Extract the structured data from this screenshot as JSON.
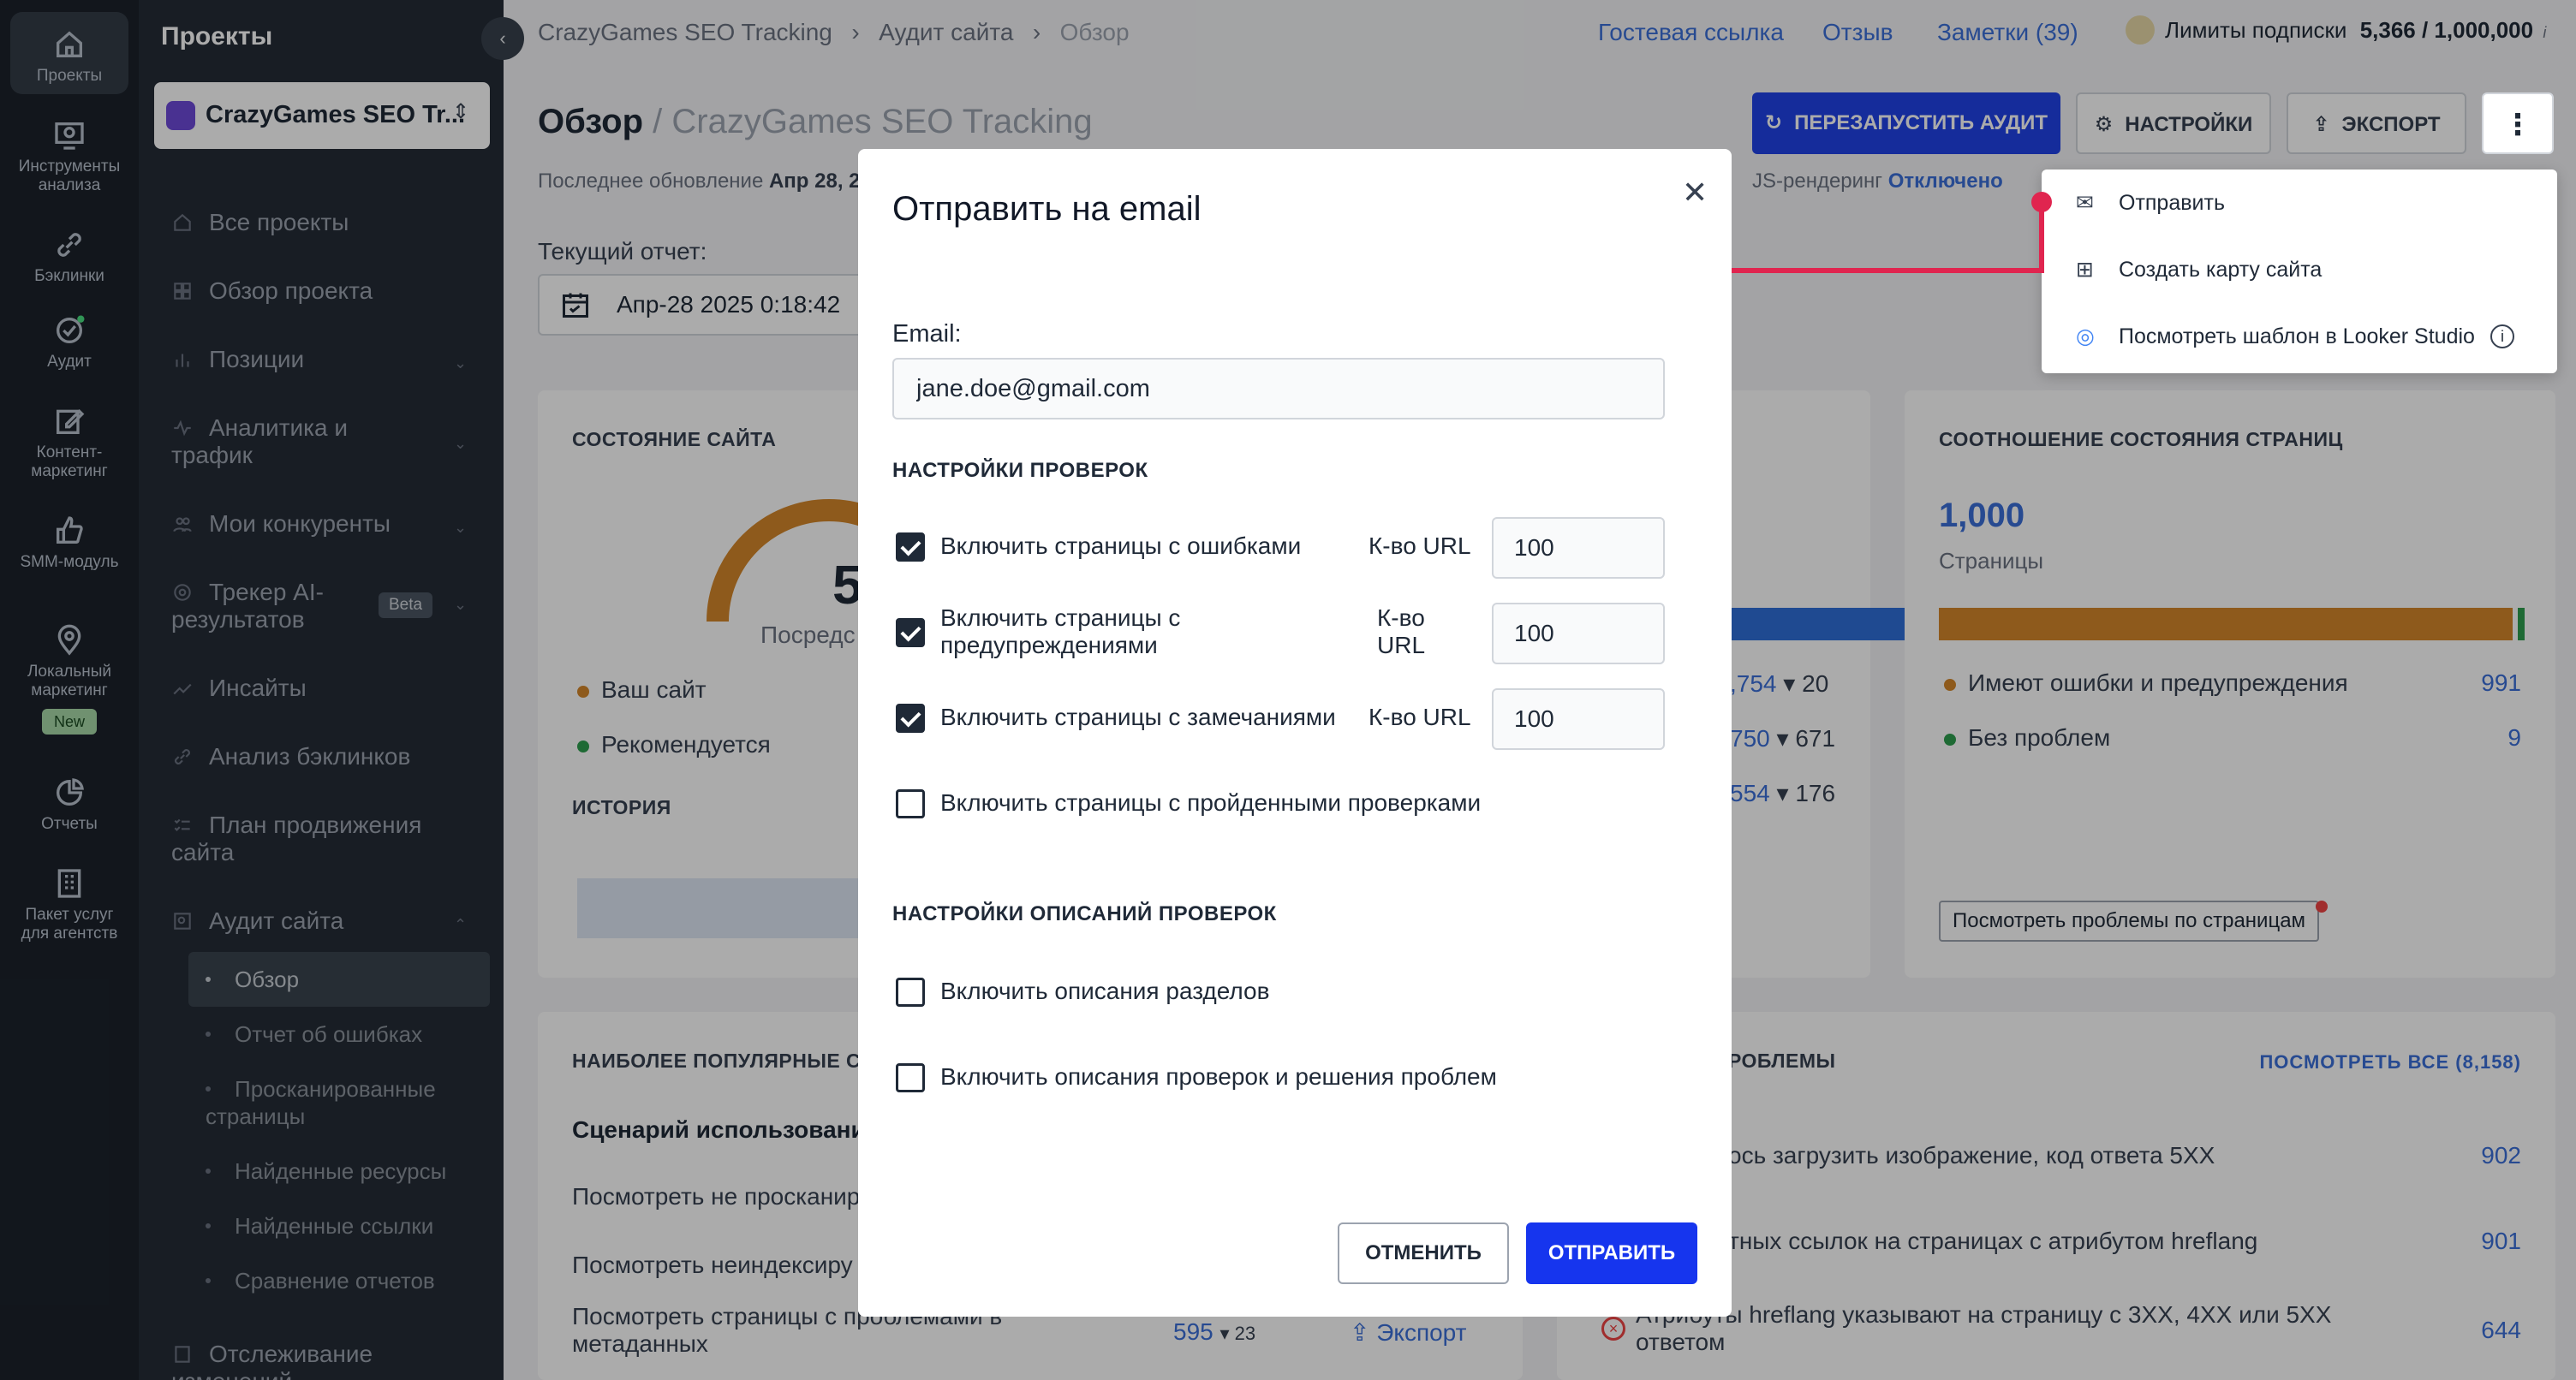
{
  "rail": [
    {
      "label": "Проекты",
      "icon": "home-icon"
    },
    {
      "label": "Инструменты анализа",
      "icon": "analysis-icon"
    },
    {
      "label": "Бэклинки",
      "icon": "link-icon"
    },
    {
      "label": "Аудит",
      "icon": "audit-icon"
    },
    {
      "label": "Контент-маркетинг",
      "icon": "edit-icon"
    },
    {
      "label": "SMM-модуль",
      "icon": "thumb-icon"
    },
    {
      "label": "Локальный маркетинг",
      "icon": "pin-icon",
      "badge": "New"
    },
    {
      "label": "Отчеты",
      "icon": "pie-icon"
    },
    {
      "label": "Пакет услуг для агентств",
      "icon": "building-icon"
    }
  ],
  "sidebar": {
    "title": "Проекты",
    "project": "CrazyGames SEO Tr...",
    "nav": [
      {
        "label": "Все проекты"
      },
      {
        "label": "Обзор проекта"
      },
      {
        "label": "Позиции"
      },
      {
        "label": "Аналитика и трафик"
      },
      {
        "label": "Мои конкуренты"
      },
      {
        "label": "Трекер AI-результатов",
        "badge": "Beta"
      },
      {
        "label": "Инсайты"
      },
      {
        "label": "Анализ бэклинков"
      },
      {
        "label": "План продвижения сайта"
      },
      {
        "label": "Аудит сайта"
      }
    ],
    "sub": [
      "Обзор",
      "Отчет об ошибках",
      "Просканированные страницы",
      "Найденные ресурсы",
      "Найденные ссылки",
      "Сравнение отчетов"
    ],
    "last": "Отслеживание изменений"
  },
  "topbar": {
    "crumbs": [
      "CrazyGames SEO Tracking",
      "Аудит сайта",
      "Обзор"
    ],
    "links": [
      "Гостевая ссылка",
      "Отзыв",
      "Заметки (39)"
    ],
    "limits_label": "Лимиты подписки",
    "limits_value": "5,366 / 1,000,000"
  },
  "page": {
    "title": "Обзор",
    "subtitle": "/ CrazyGames SEO Tracking",
    "updated_label": "Последнее обновление",
    "updated_value": "Апр 28, 2",
    "js_label": "JS-рендеринг",
    "js_value": "Отключено",
    "report_label": "Текущий отчет:",
    "report_value": "Апр-28 2025 0:18:42",
    "btn_restart": "ПЕРЕЗАПУСТИТЬ АУДИТ",
    "btn_settings": "НАСТРОЙКИ",
    "btn_export": "ЭКСПОРТ"
  },
  "cards": {
    "site_state": {
      "title": "СОСТОЯНИЕ САЙТА",
      "big": "5",
      "avg": "Посредс",
      "your_site": "Ваш сайт",
      "recommended": "Рекомендуется",
      "history": "ИСТОРИЯ"
    },
    "mid": {
      "r1a": ",754",
      "r1b": "20",
      "r2a": "750",
      "r2b": "671",
      "r3a": "554",
      "r3b": "176"
    },
    "ratio": {
      "title": "СООТНОШЕНИЕ СОСТОЯНИЯ СТРАНИЦ",
      "value": "1,000",
      "unit": "Страницы",
      "row1": "Имеют ошибки и предупреждения",
      "row1v": "991",
      "row2": "Без проблем",
      "row2v": "9",
      "btn": "Посмотреть проблемы по страницам",
      "orange": "#d4872a",
      "green": "#2e9e4e"
    },
    "popular": {
      "title": "НАИБОЛЕЕ ПОПУЛЯРНЫЕ СЦ",
      "scenario": "Сценарий использовани",
      "r1": "Посмотреть не просканир",
      "r2": "Посмотреть неиндексиру",
      "r3": "Посмотреть страницы с проблемами в метаданных",
      "r3a": "595",
      "r3b": "23",
      "r3c": "Экспорт"
    },
    "problems": {
      "title": "РОБЛЕМЫ",
      "view_all": "ПОСМОТРЕТЬ ВСЕ (8,158)",
      "p1": "ось загрузить изображение, код ответа 5XX",
      "p1v": "902",
      "p2": "тных ссылок на страницах с атрибутом hreflang",
      "p2v": "901",
      "p3": "Атрибуты hreflang указывают на страницу с 3XX, 4XX или 5XX ответом",
      "p3v": "644"
    }
  },
  "dropdown": {
    "items": [
      {
        "label": "Отправить",
        "icon": "mail-icon"
      },
      {
        "label": "Создать карту сайта",
        "icon": "sitemap-icon"
      },
      {
        "label": "Посмотреть шаблон в Looker Studio",
        "icon": "looker-icon"
      }
    ]
  },
  "modal": {
    "title": "Отправить на email",
    "email_label": "Email:",
    "email_value": "jane.doe@gmail.com",
    "section1": "НАСТРОЙКИ ПРОВЕРОК",
    "checks": [
      {
        "label": "Включить страницы с ошибками",
        "checked": true,
        "url_label": "К-во URL",
        "url_value": "100"
      },
      {
        "label": "Включить страницы с предупреждениями",
        "checked": true,
        "url_label": "К-во URL",
        "url_value": "100"
      },
      {
        "label": "Включить страницы с замечаниями",
        "checked": true,
        "url_label": "К-во URL",
        "url_value": "100"
      },
      {
        "label": "Включить страницы с пройденными проверками",
        "checked": false
      }
    ],
    "section2": "НАСТРОЙКИ ОПИСАНИЙ ПРОВЕРОК",
    "desc_checks": [
      {
        "label": "Включить описания разделов",
        "checked": false
      },
      {
        "label": "Включить описания проверок и решения проблем",
        "checked": false
      }
    ],
    "cancel": "ОТМЕНИТЬ",
    "send": "ОТПРАВИТЬ"
  },
  "colors": {
    "accent": "#2042e8",
    "arrow": "#e0254f",
    "sidebar": "#242c36",
    "rail": "#1b222b"
  }
}
